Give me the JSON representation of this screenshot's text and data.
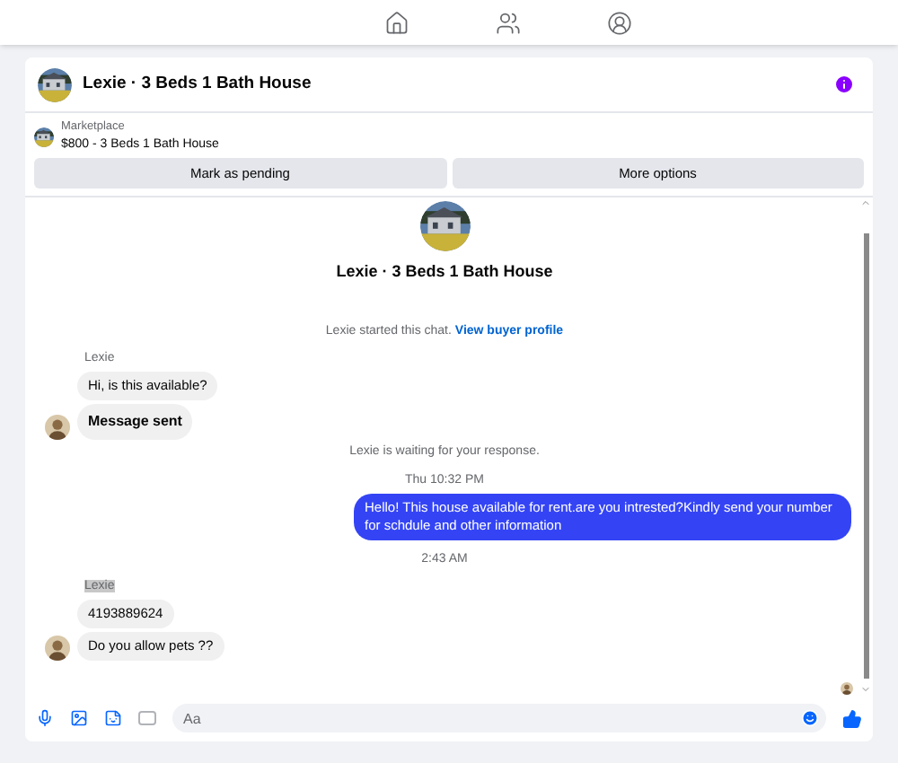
{
  "conversation": {
    "title": "Lexie · 3 Beds 1 Bath House"
  },
  "listing": {
    "source": "Marketplace",
    "summary": "$800 - 3 Beds 1 Bath House"
  },
  "actions": [
    "Mark as pending",
    "More options"
  ],
  "chat_header": {
    "title": "Lexie · 3 Beds 1 Bath House"
  },
  "messages": [
    {
      "kind": "system",
      "text": "Lexie started this chat.",
      "link": "View buyer profile"
    },
    {
      "kind": "sender",
      "text": "Lexie",
      "highlighted": false
    },
    {
      "kind": "incoming",
      "text": "Hi, is this available?",
      "bold": false,
      "avatar": false
    },
    {
      "kind": "incoming",
      "text": "Message sent",
      "bold": true,
      "avatar": true
    },
    {
      "kind": "system",
      "text": "Lexie is waiting for your response."
    },
    {
      "kind": "timestamp",
      "text": "Thu 10:32 PM"
    },
    {
      "kind": "outgoing",
      "text": "Hello! This house available for rent.are you intrested?Kindly send your number for schdule and other information"
    },
    {
      "kind": "timestamp",
      "text": "2:43 AM"
    },
    {
      "kind": "sender",
      "text": "Lexie",
      "highlighted": true
    },
    {
      "kind": "incoming",
      "text": "4193889624",
      "bold": false,
      "avatar": false
    },
    {
      "kind": "incoming",
      "text": "Do you allow pets ??",
      "bold": false,
      "avatar": true
    }
  ],
  "composer": {
    "placeholder": "Aa"
  }
}
